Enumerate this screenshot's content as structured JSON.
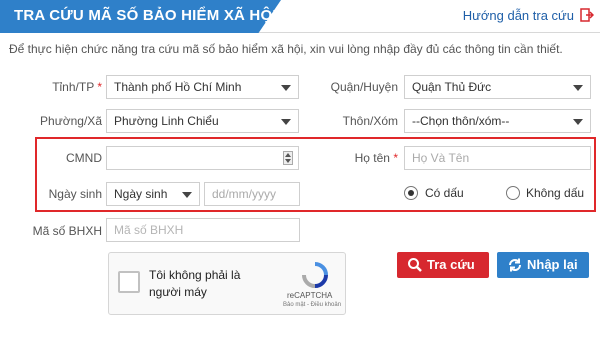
{
  "header": {
    "title": "TRA CỨU MÃ SỐ BẢO HIỂM XÃ HỘI",
    "guide_link": "Hướng dẫn tra cứu"
  },
  "intro": "Để thực hiện chức năng tra cứu mã số bảo hiểm xã hội, xin vui lòng nhập đầy đủ các thông tin cần thiết.",
  "form": {
    "province": {
      "label": "Tỉnh/TP",
      "required": "*",
      "value": "Thành phố Hồ Chí Minh"
    },
    "district": {
      "label": "Quận/Huyện",
      "value": "Quận Thủ Đức"
    },
    "ward": {
      "label": "Phường/Xã",
      "value": "Phường Linh Chiểu"
    },
    "hamlet": {
      "label": "Thôn/Xóm",
      "value": "--Chọn thôn/xóm--"
    },
    "id_number": {
      "label": "CMND",
      "value": ""
    },
    "full_name": {
      "label": "Họ tên",
      "required": "*",
      "placeholder": "Họ Và Tên"
    },
    "birthdate": {
      "label": "Ngày sinh",
      "type_value": "Ngày sinh",
      "placeholder": "dd/mm/yyyy"
    },
    "accent": {
      "with": "Có dấu",
      "without": "Không dấu",
      "selected": "with"
    },
    "bhxh_code": {
      "label": "Mã số BHXH",
      "placeholder": "Mã số BHXH"
    }
  },
  "captcha": {
    "text": "Tôi không phải là người máy",
    "brand": "reCAPTCHA",
    "terms": "Bảo mật - Điều khoản"
  },
  "buttons": {
    "search": "Tra cứu",
    "reset": "Nhập lại"
  },
  "colors": {
    "primary": "#2f80c9",
    "danger": "#d7282f",
    "highlight_border": "#e0282a"
  }
}
